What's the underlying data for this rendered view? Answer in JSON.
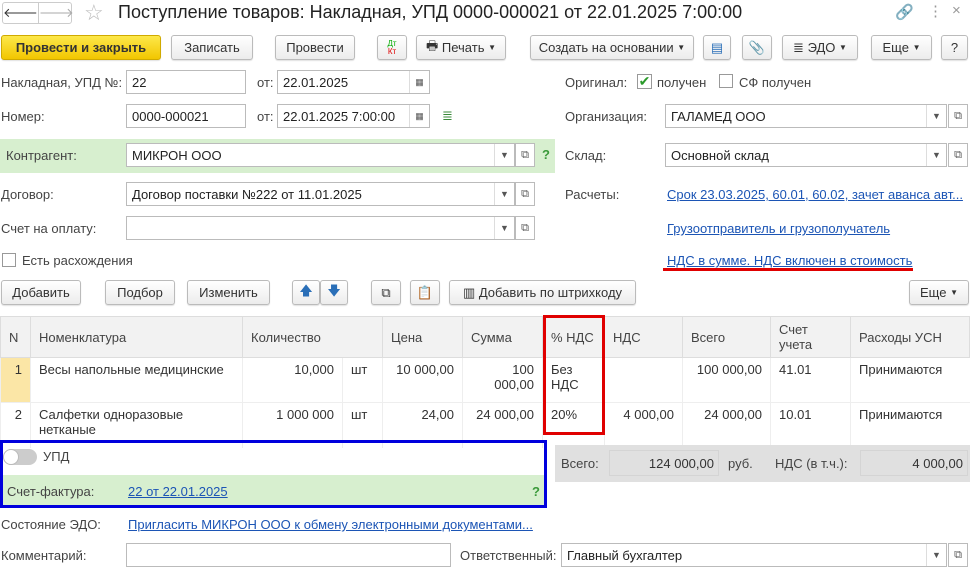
{
  "title": "Поступление товаров: Накладная, УПД 0000-000021 от 22.01.2025 7:00:00",
  "toolbar": {
    "post_close": "Провести и закрыть",
    "save": "Записать",
    "post": "Провести",
    "dtkt_dt": "Дт",
    "dtkt_kt": "Кт",
    "print": "Печать",
    "create_based": "Создать на основании",
    "edo": "ЭДО",
    "more": "Еще",
    "help": "?"
  },
  "form": {
    "invoice_label": "Накладная, УПД №:",
    "invoice_no": "22",
    "from_label": "от:",
    "invoice_date": "22.01.2025",
    "number_label": "Номер:",
    "number": "0000-000021",
    "number_date": "22.01.2025  7:00:00",
    "counterparty_label": "Контрагент:",
    "counterparty": "МИКРОН ООО",
    "q": "?",
    "contract_label": "Договор:",
    "contract": "Договор поставки №222 от 11.01.2025",
    "payment_label": "Счет на оплату:",
    "payment": "",
    "discrepancy_label": "Есть расхождения",
    "original_label": "Оригинал:",
    "received": "получен",
    "sf_received": "СФ получен",
    "org_label": "Организация:",
    "org": "ГАЛАМЕД ООО",
    "warehouse_label": "Склад:",
    "warehouse": "Основной склад",
    "settlements_label": "Расчеты:",
    "settlements_link": "Срок 23.03.2025, 60.01, 60.02, зачет аванса авт...",
    "shipper_link": "Грузоотправитель и грузополучатель",
    "vat_link": "НДС в сумме. НДС включен в стоимость"
  },
  "table_toolbar": {
    "add": "Добавить",
    "select": "Подбор",
    "change": "Изменить",
    "barcode": "Добавить по штрихкоду",
    "more": "Еще"
  },
  "table": {
    "columns": [
      "N",
      "Номенклатура",
      "Количество",
      "",
      "Цена",
      "Сумма",
      "% НДС",
      "НДС",
      "Всего",
      "Счет учета",
      "Расходы УСН"
    ],
    "rows": [
      [
        "1",
        "Весы напольные медицинские",
        "10,000",
        "шт",
        "10 000,00",
        "100 000,00",
        "Без НДС",
        "",
        "100 000,00",
        "41.01",
        "Принимаются"
      ],
      [
        "2",
        "Салфетки одноразовые нетканые",
        "1 000 000",
        "шт",
        "24,00",
        "24 000,00",
        "20%",
        "4 000,00",
        "24 000,00",
        "10.01",
        "Принимаются"
      ]
    ]
  },
  "upd": {
    "label": "УПД",
    "sf_label": "Счет-фактура:",
    "sf_link": "22 от 22.01.2025",
    "q": "?"
  },
  "totals": {
    "total_label": "Всего:",
    "total": "124 000,00",
    "currency": "руб.",
    "vat_label": "НДС (в т.ч.):",
    "vat": "4 000,00"
  },
  "footer": {
    "edo_label": "Состояние ЭДО:",
    "edo_link": "Пригласить МИКРОН ООО к обмену электронными документами...",
    "comment_label": "Комментарий:",
    "comment": "",
    "resp_label": "Ответственный:",
    "resp": "Главный бухгалтер"
  },
  "colors": {
    "accent_yellow": "#f2c600",
    "link": "#1c55b5",
    "highlight_red": "#e00000",
    "highlight_blue": "#0000dd",
    "green_band": "#d7efcf"
  }
}
